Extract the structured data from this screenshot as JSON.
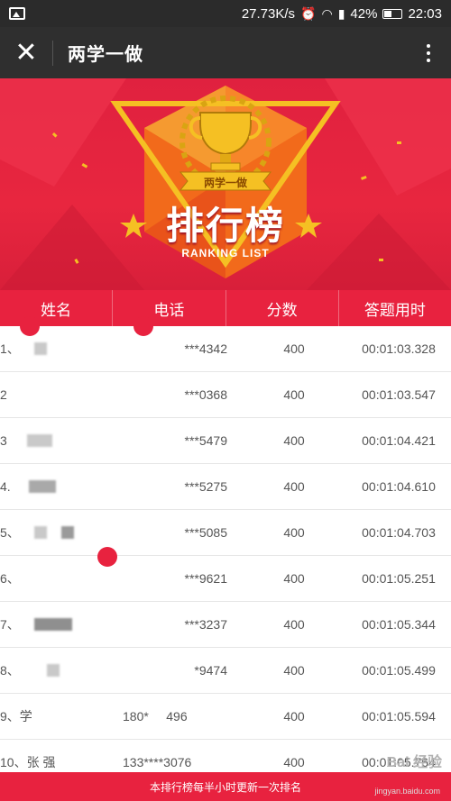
{
  "status_bar": {
    "speed": "27.73K/s",
    "battery": "42%",
    "time": "22:03",
    "battery_level": 0.42
  },
  "titlebar": {
    "title": "两学一做"
  },
  "banner": {
    "ribbon": "两学一做",
    "title_cn": "排行榜",
    "title_en": "RANKING LIST"
  },
  "table": {
    "headers": [
      "姓名",
      "电话",
      "分数",
      "答题用时"
    ],
    "rows": [
      {
        "rank": "1、",
        "phone": "***4342",
        "score": "400",
        "time": "00:01:03.328"
      },
      {
        "rank": "2",
        "phone": "***0368",
        "score": "400",
        "time": "00:01:03.547"
      },
      {
        "rank": "3",
        "phone": "***5479",
        "score": "400",
        "time": "00:01:04.421"
      },
      {
        "rank": "4.",
        "phone": "***5275",
        "score": "400",
        "time": "00:01:04.610"
      },
      {
        "rank": "5、",
        "phone": "***5085",
        "score": "400",
        "time": "00:01:04.703"
      },
      {
        "rank": "6、",
        "phone": "***9621",
        "score": "400",
        "time": "00:01:05.251"
      },
      {
        "rank": "7、",
        "phone": "***3237",
        "score": "400",
        "time": "00:01:05.344"
      },
      {
        "rank": "8、",
        "phone": "*9474",
        "score": "400",
        "time": "00:01:05.499"
      },
      {
        "rank": "9、学",
        "phone": "180*     496",
        "score": "400",
        "time": "00:01:05.594"
      },
      {
        "rank": "10、张 强",
        "phone": "133****3076",
        "score": "400",
        "time": "00:01:05.764"
      }
    ]
  },
  "footer": {
    "note": "本排行榜每半小时更新一次排名"
  },
  "watermark": {
    "brand": "Bai 经验",
    "url": "jingyan.baidu.com"
  },
  "colors": {
    "accent": "#e8223f",
    "statusbar": "#2b2b2b",
    "titlebar": "#2f2f2f",
    "gold": "#f5c023"
  }
}
